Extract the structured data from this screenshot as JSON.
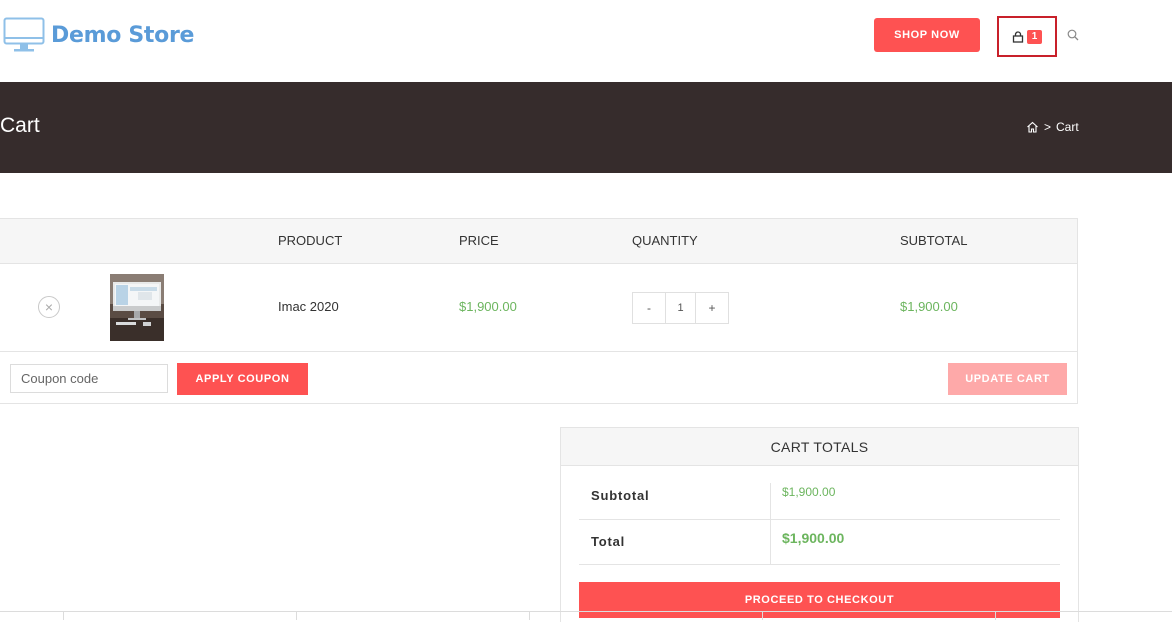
{
  "header": {
    "logo_text": "Demo Store",
    "shop_now_label": "SHOP NOW",
    "cart_count": "1"
  },
  "title_bar": {
    "page_title": "Cart",
    "breadcrumb_current": "Cart",
    "breadcrumb_sep": ">"
  },
  "cart_table": {
    "columns": [
      "PRODUCT",
      "PRICE",
      "QUANTITY",
      "SUBTOTAL"
    ],
    "items": [
      {
        "remove_symbol": "×",
        "name": "Imac 2020",
        "price": "$1,900.00",
        "quantity": "1",
        "subtotal": "$1,900.00"
      }
    ],
    "qty_minus": "-",
    "qty_plus": "+"
  },
  "actions": {
    "coupon_placeholder": "Coupon code",
    "apply_coupon_label": "APPLY COUPON",
    "update_cart_label": "UPDATE CART"
  },
  "totals": {
    "title": "CART TOTALS",
    "subtotal_label": "Subtotal",
    "subtotal_value": "$1,900.00",
    "total_label": "Total",
    "total_value": "$1,900.00",
    "checkout_label": "PROCEED TO CHECKOUT"
  },
  "colors": {
    "accent": "#fe5252",
    "accent_disabled": "#fea9a9",
    "title_bar_bg": "#362c2c",
    "price_green": "#6cb55e",
    "logo_blue": "#5a9bd8"
  },
  "icons": [
    "monitor-logo-icon",
    "shopping-bag-icon",
    "search-icon",
    "home-icon",
    "remove-icon"
  ]
}
